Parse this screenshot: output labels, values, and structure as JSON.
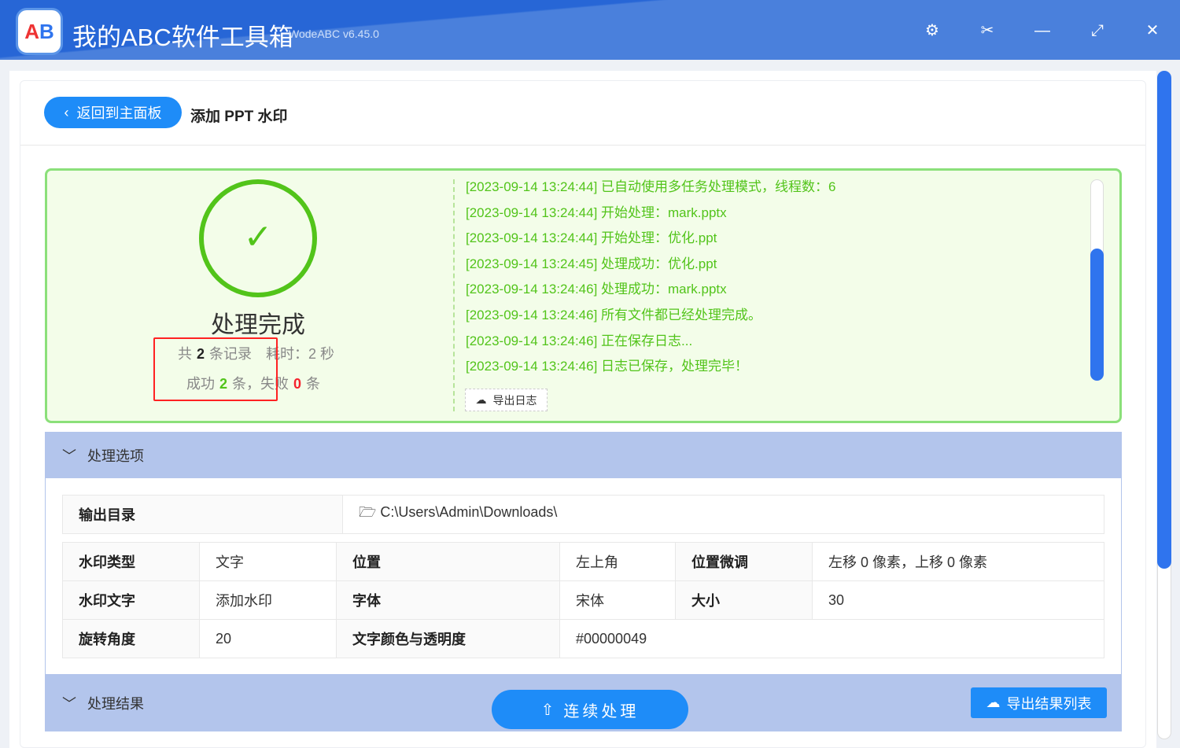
{
  "app": {
    "title": "我的ABC软件工具箱",
    "version": "WodeABC v6.45.0",
    "logo_text": "AB"
  },
  "window_controls": [
    "settings-icon",
    "scissors-icon",
    "minimize-icon",
    "maximize-icon",
    "close-icon"
  ],
  "header": {
    "back_label": "返回到主面板",
    "page_title": "添加 PPT 水印"
  },
  "result": {
    "status": "处理完成",
    "total_prefix": "共",
    "total": "2",
    "total_suffix": "条记录",
    "elapsed": "耗时：2 秒",
    "success_prefix": "成功",
    "success": "2",
    "success_suffix": "条，失败",
    "fail": "0",
    "fail_suffix": "条"
  },
  "log": {
    "lines": [
      "[2023-09-14 13:24:44] 已自动使用多任务处理模式，线程数：6",
      "[2023-09-14 13:24:44] 开始处理：mark.pptx",
      "[2023-09-14 13:24:44] 开始处理：优化.ppt",
      "[2023-09-14 13:24:45] 处理成功：优化.ppt",
      "[2023-09-14 13:24:46] 处理成功：mark.pptx",
      "[2023-09-14 13:24:46] 所有文件都已经处理完成。",
      "[2023-09-14 13:24:46] 正在保存日志...",
      "[2023-09-14 13:24:46] 日志已保存，处理完毕！"
    ],
    "export_label": "导出日志"
  },
  "options": {
    "title": "处理选项",
    "output_dir_label": "输出目录",
    "output_dir": "C:\\Users\\Admin\\Downloads\\",
    "rows": [
      [
        "水印类型",
        "文字",
        "位置",
        "左上角",
        "位置微调",
        "左移 0 像素，上移 0 像素"
      ],
      [
        "水印文字",
        "添加水印",
        "字体",
        "宋体",
        "大小",
        "30"
      ],
      [
        "旋转角度",
        "20",
        "文字颜色与透明度",
        "#00000049",
        "",
        ""
      ]
    ]
  },
  "results": {
    "title": "处理结果",
    "continue_label": "连续处理",
    "export_label": "导出结果列表"
  }
}
